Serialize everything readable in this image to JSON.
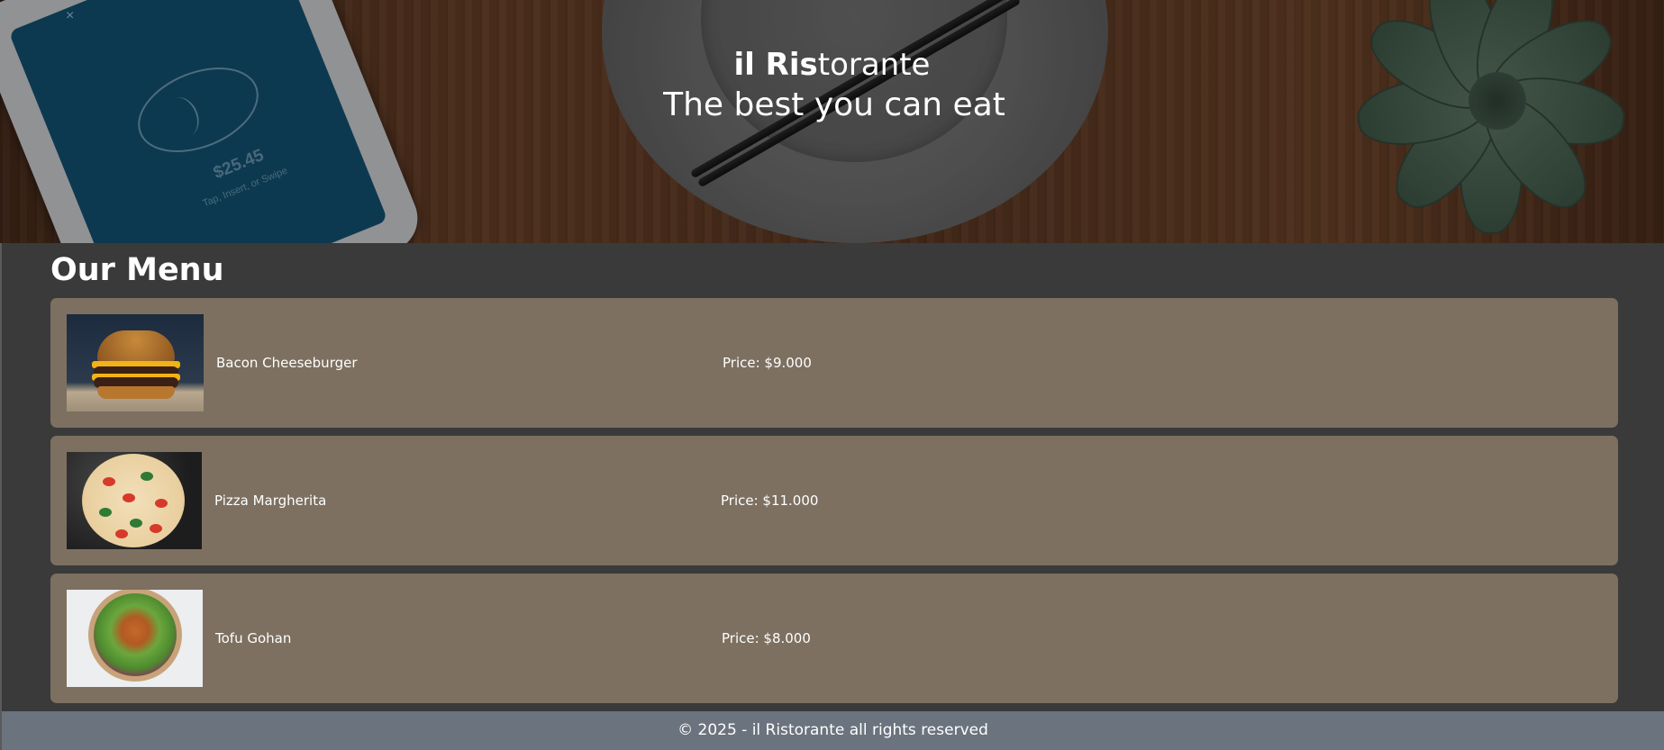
{
  "hero": {
    "title_bold": "il Ris",
    "title_rest": "torante",
    "subtitle": "The best you can eat",
    "terminal_amount": "$25.45",
    "terminal_hint": "Tap, Insert, or Swipe",
    "close_glyph": "×"
  },
  "menu": {
    "heading": "Our Menu",
    "items": [
      {
        "name": "Bacon Cheeseburger",
        "price": "Price: $9.000",
        "image": "burger-photo"
      },
      {
        "name": "Pizza Margherita",
        "price": "Price: $11.000",
        "image": "pizza-photo"
      },
      {
        "name": "Tofu Gohan",
        "price": "Price: $8.000",
        "image": "bowl-photo"
      }
    ]
  },
  "footer": {
    "text": "© 2025 - il Ristorante all rights reserved"
  },
  "colors": {
    "page_bg": "#3a3a3a",
    "card_bg": "#7d7060",
    "footer_bg": "#6b737e",
    "text": "#ffffff"
  }
}
